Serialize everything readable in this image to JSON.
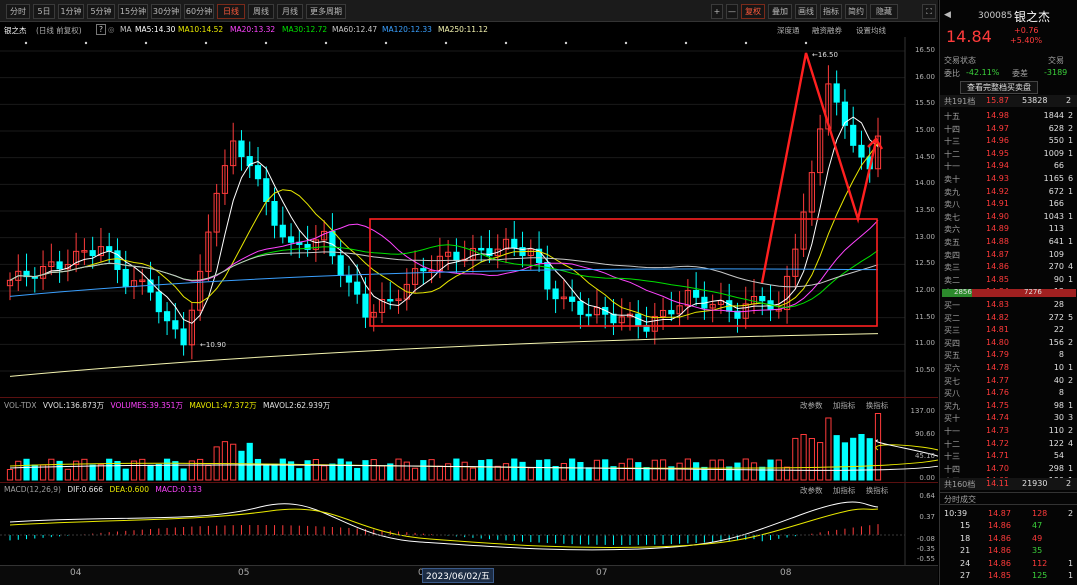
{
  "toolbar": {
    "periods": [
      "分时",
      "5日",
      "1分钟",
      "5分钟",
      "15分钟",
      "30分钟",
      "60分钟",
      "日线",
      "周线",
      "月线",
      "更多周期"
    ],
    "active": "日线",
    "right_buttons": [
      "+",
      "—",
      "复权",
      "叠加",
      "画线",
      "指标",
      "简约",
      "隐藏"
    ]
  },
  "info": {
    "name": "银之杰",
    "mode": "(日线 前复权)",
    "help": "?",
    "ma_label": "MA",
    "ma5": "MA5:14.30",
    "ma10": "MA10:14.52",
    "ma20": "MA20:13.32",
    "ma30": "MA30:12.72",
    "ma60": "MA60:12.47",
    "ma120": "MA120:12.33",
    "ma250": "MA250:11.12",
    "links": [
      "深度通",
      "融资融券",
      "设置均线"
    ]
  },
  "price_axis": [
    "16.50",
    "16.00",
    "15.50",
    "15.00",
    "14.50",
    "14.00",
    "13.50",
    "13.00",
    "12.50",
    "12.00",
    "11.50",
    "11.00",
    "10.50"
  ],
  "annotations": {
    "high": "16.50",
    "low": "10.90"
  },
  "volume": {
    "label": "VOL-TDX",
    "vvol": "VVOL:136.873万",
    "volumes": "VOLUMES:39.351万",
    "mavol1": "MAVOL1:47.372万",
    "mavol2": "MAVOL2:62.939万",
    "links": [
      "改参数",
      "加指标",
      "换指标"
    ],
    "axis": [
      "137.00",
      "90.60",
      "45.10",
      "0.00"
    ]
  },
  "macd": {
    "label": "MACD(12,26,9)",
    "dif": "DIF:0.666",
    "dea": "DEA:0.600",
    "macd": "MACD:0.133",
    "links": [
      "改参数",
      "加指标",
      "换指标"
    ],
    "axis": [
      "0.64",
      "0.37",
      "-0.08",
      "-0.35",
      "-0.55"
    ]
  },
  "bottom": {
    "months": [
      "04",
      "05",
      "06",
      "07",
      "08"
    ],
    "date_box": "2023/06/02/五"
  },
  "quote": {
    "code": "300085",
    "name": "银之杰",
    "price": "14.84",
    "change": "+0.76",
    "pct": "+5.40%",
    "state_label": "交易状态",
    "state_label2": "交易",
    "wb_label": "委比",
    "wb": "-42.11%",
    "wc_label": "委差",
    "wc": "-3189",
    "full_btn": "查看完整档买卖盘",
    "sell_total_label": "共191档",
    "sell_total_price": "15.87",
    "sell_total_vol": "53828",
    "sell_total_n": "2",
    "sells": [
      {
        "label": "十五",
        "price": "14.98",
        "vol": "1844",
        "n": "2"
      },
      {
        "label": "十四",
        "price": "14.97",
        "vol": "628",
        "n": "2"
      },
      {
        "label": "十三",
        "price": "14.96",
        "vol": "550",
        "n": "1"
      },
      {
        "label": "十二",
        "price": "14.95",
        "vol": "1009",
        "n": "1"
      },
      {
        "label": "十一",
        "price": "14.94",
        "vol": "66",
        "n": ""
      },
      {
        "label": "卖十",
        "price": "14.93",
        "vol": "1165",
        "n": "6"
      },
      {
        "label": "卖九",
        "price": "14.92",
        "vol": "672",
        "n": "1"
      },
      {
        "label": "卖八",
        "price": "14.91",
        "vol": "166",
        "n": ""
      },
      {
        "label": "卖七",
        "price": "14.90",
        "vol": "1043",
        "n": "1"
      },
      {
        "label": "卖六",
        "price": "14.89",
        "vol": "113",
        "n": ""
      },
      {
        "label": "卖五",
        "price": "14.88",
        "vol": "641",
        "n": "1"
      },
      {
        "label": "卖四",
        "price": "14.87",
        "vol": "109",
        "n": ""
      },
      {
        "label": "卖三",
        "price": "14.86",
        "vol": "270",
        "n": "4"
      },
      {
        "label": "卖二",
        "price": "14.85",
        "vol": "90",
        "n": "1"
      },
      {
        "label": "卖一",
        "price": "14.84",
        "vol": "13",
        "n": ""
      }
    ],
    "ratio_left": "2856",
    "ratio_right": "7276",
    "buys": [
      {
        "label": "买一",
        "price": "14.83",
        "vol": "28",
        "n": ""
      },
      {
        "label": "买二",
        "price": "14.82",
        "vol": "272",
        "n": "5"
      },
      {
        "label": "买三",
        "price": "14.81",
        "vol": "22",
        "n": ""
      },
      {
        "label": "买四",
        "price": "14.80",
        "vol": "156",
        "n": "2"
      },
      {
        "label": "买五",
        "price": "14.79",
        "vol": "8",
        "n": ""
      },
      {
        "label": "买六",
        "price": "14.78",
        "vol": "10",
        "n": "1"
      },
      {
        "label": "买七",
        "price": "14.77",
        "vol": "40",
        "n": "2"
      },
      {
        "label": "买八",
        "price": "14.76",
        "vol": "8",
        "n": ""
      },
      {
        "label": "买九",
        "price": "14.75",
        "vol": "98",
        "n": "1"
      },
      {
        "label": "买十",
        "price": "14.74",
        "vol": "30",
        "n": "3"
      },
      {
        "label": "十一",
        "price": "14.73",
        "vol": "110",
        "n": "2"
      },
      {
        "label": "十二",
        "price": "14.72",
        "vol": "122",
        "n": "4"
      },
      {
        "label": "十三",
        "price": "14.71",
        "vol": "54",
        "n": ""
      },
      {
        "label": "十四",
        "price": "14.70",
        "vol": "298",
        "n": "1"
      },
      {
        "label": "十五",
        "price": "14.69",
        "vol": "180",
        "n": "1"
      }
    ],
    "buy_total_label": "共160档",
    "buy_total_price": "14.11",
    "buy_total_vol": "21930",
    "buy_total_n": "2",
    "ticks_title": "分时成交",
    "ticks": [
      {
        "time": "10:39",
        "price": "14.87",
        "vol": "128",
        "n": "2"
      },
      {
        "time": "15",
        "price": "14.86",
        "vol": "47",
        "n": ""
      },
      {
        "time": "18",
        "price": "14.86",
        "vol": "49",
        "n": ""
      },
      {
        "time": "21",
        "price": "14.86",
        "vol": "35",
        "n": ""
      },
      {
        "time": "24",
        "price": "14.86",
        "vol": "112",
        "n": "1"
      },
      {
        "time": "27",
        "price": "14.85",
        "vol": "125",
        "n": "1"
      }
    ]
  },
  "colors": {
    "up": "#ff3b3b",
    "down": "#00ffff",
    "ma5": "#ffffff",
    "ma10": "#e8e800",
    "ma20": "#ff44ff",
    "ma30": "#00e000",
    "ma60": "#c8c8c8",
    "ma120": "#3aa0ff",
    "ma250": "#f5f5b0"
  }
}
